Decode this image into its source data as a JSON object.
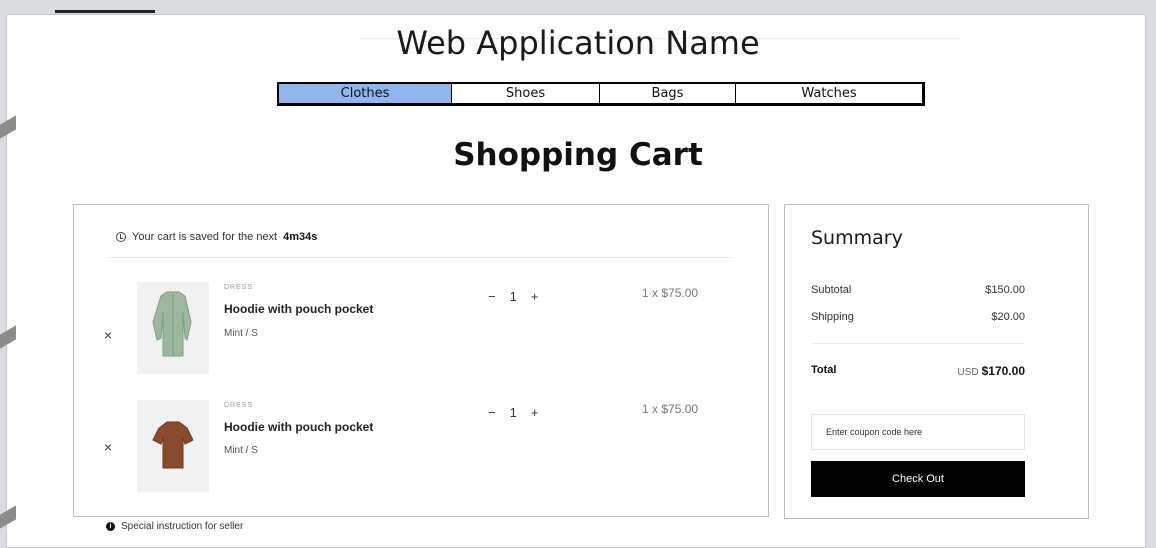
{
  "app": {
    "title": "Web Application Name"
  },
  "nav": {
    "tabs": [
      {
        "label": "Clothes",
        "active": true
      },
      {
        "label": "Shoes",
        "active": false
      },
      {
        "label": "Bags",
        "active": false
      },
      {
        "label": "Watches",
        "active": false
      }
    ],
    "active_color": "#8fb4ee"
  },
  "page": {
    "title": "Shopping Cart"
  },
  "cart": {
    "saved_text": "Your cart is saved for the next",
    "saved_time": "4m34s",
    "items": [
      {
        "remove": "×",
        "category": "DRESS",
        "name": "Hoodie with pouch pocket",
        "variant": "Mint / S",
        "qty_minus": "−",
        "quantity": "1",
        "qty_plus": "+",
        "price": "1 x $75.00",
        "image": "mint-cardigan",
        "image_color": "#9db89e"
      },
      {
        "remove": "×",
        "category": "DRESS",
        "name": "Hoodie with pouch pocket",
        "variant": "Mint / S",
        "qty_minus": "−",
        "quantity": "1",
        "qty_plus": "+",
        "price": "1 x $75.00",
        "image": "brown-tshirt",
        "image_color": "#8a4a2e"
      }
    ],
    "special_instruction": "Special instruction for seller"
  },
  "summary": {
    "title": "Summary",
    "subtotal_label": "Subtotal",
    "subtotal_value": "$150.00",
    "shipping_label": "Shipping",
    "shipping_value": "$20.00",
    "total_label": "Total",
    "total_currency": "USD",
    "total_value": "$170.00",
    "coupon_placeholder": "Enter coupon code here",
    "checkout_label": "Check Out"
  }
}
